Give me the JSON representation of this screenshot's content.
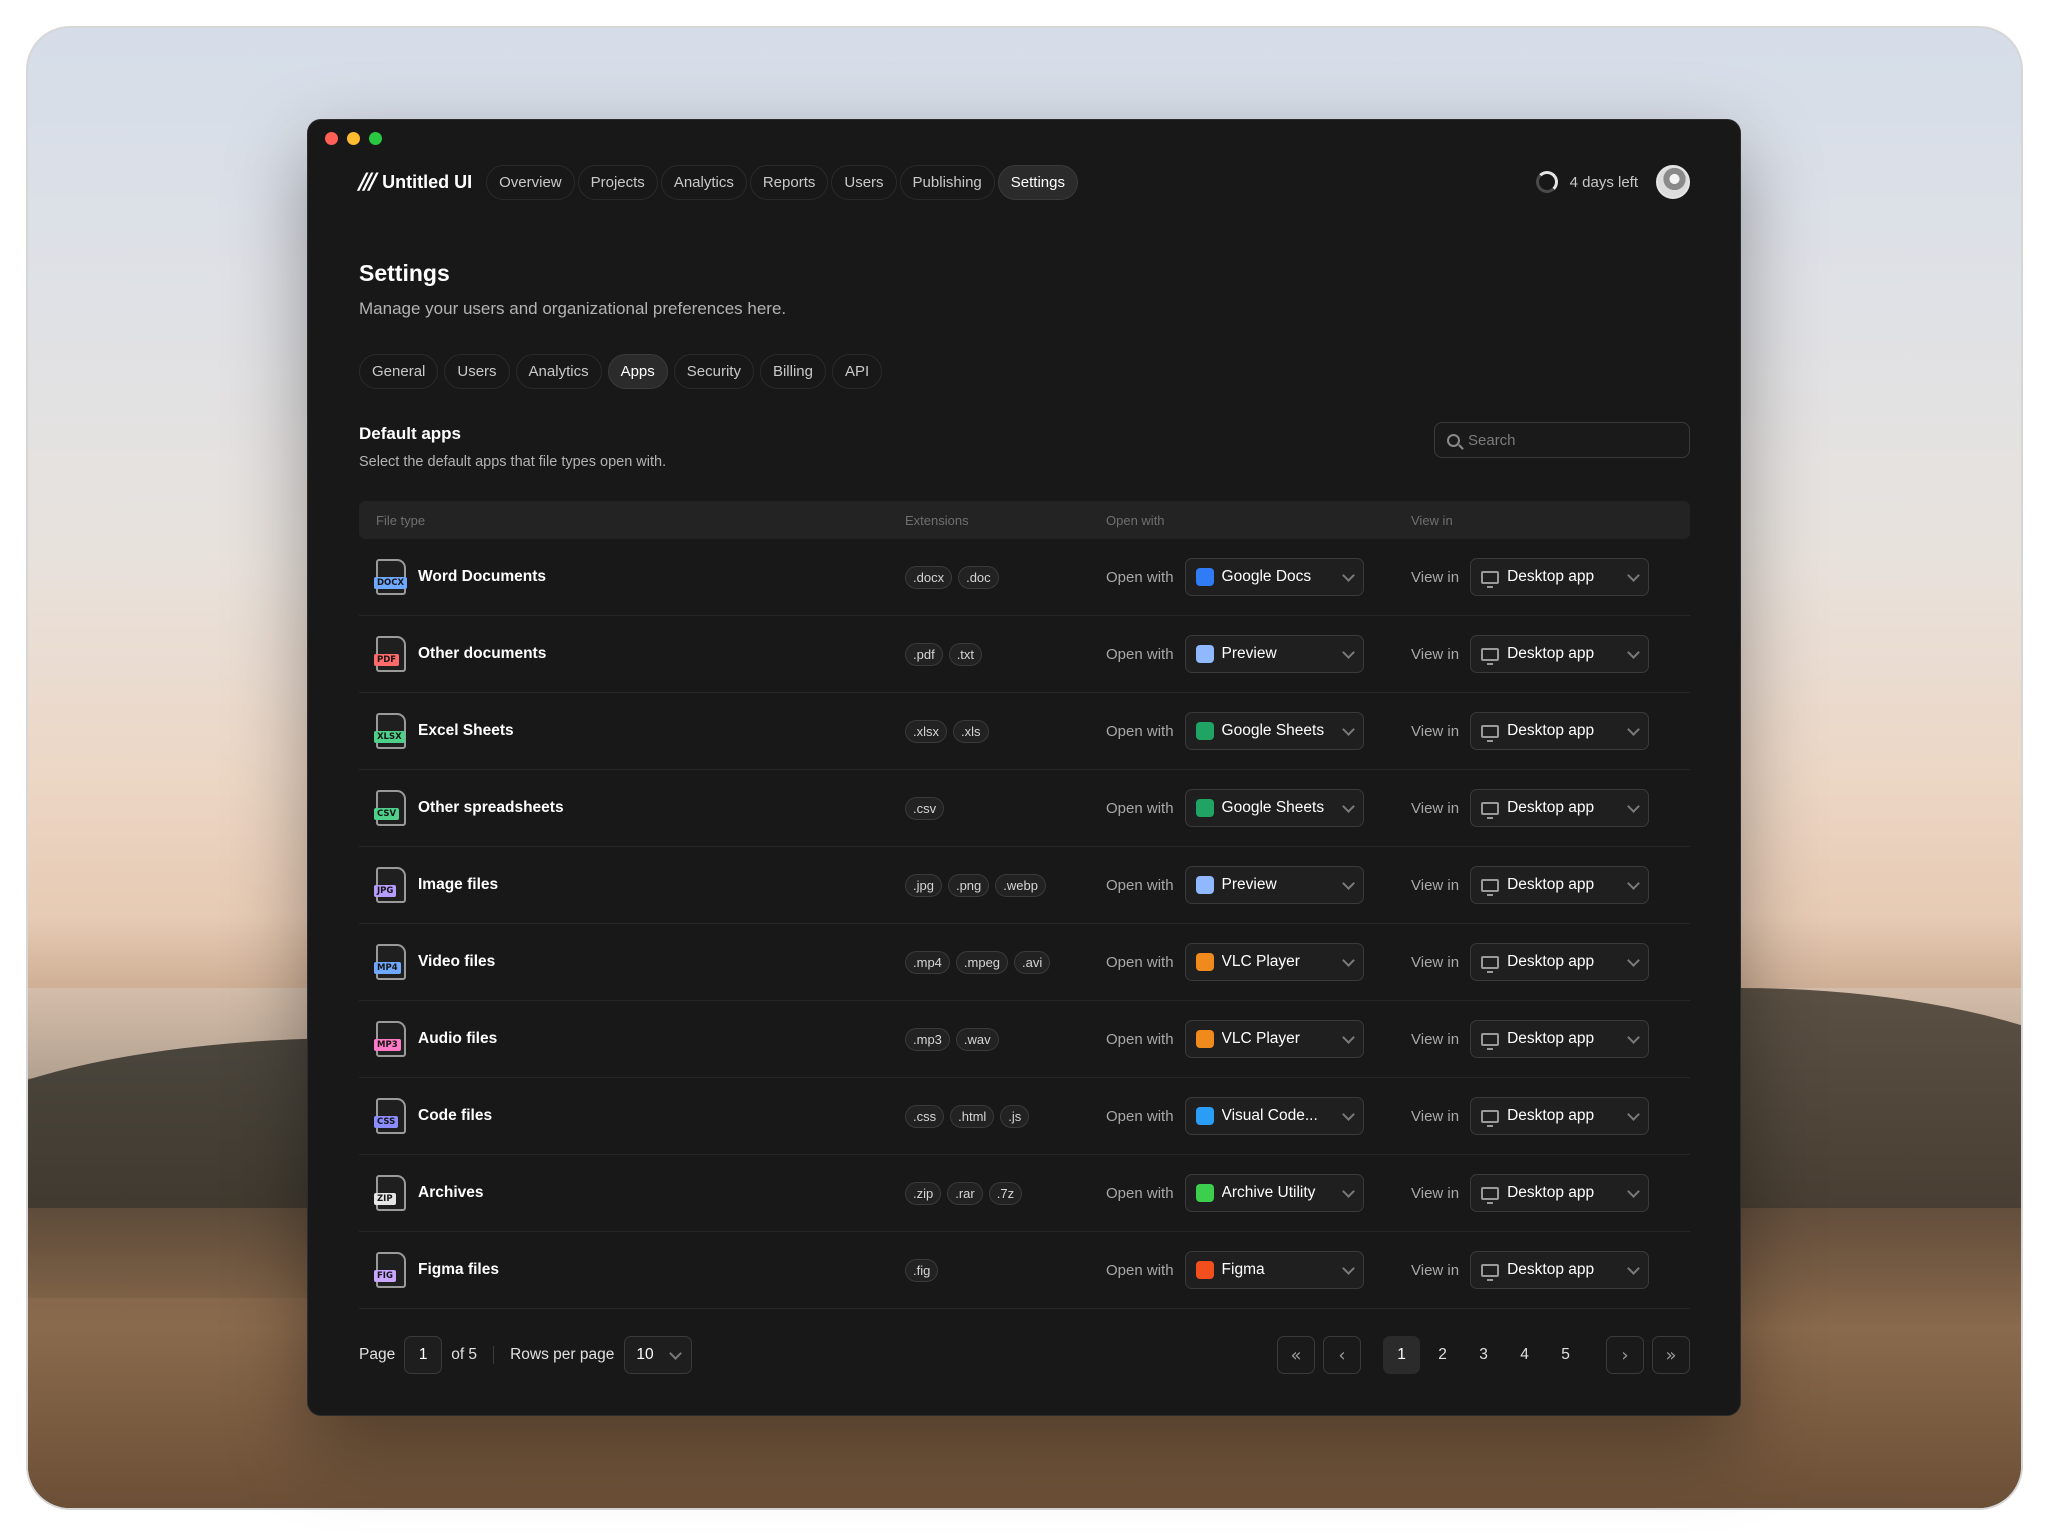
{
  "app": {
    "logo_mark": "///",
    "name": "Untitled UI"
  },
  "nav": {
    "items": [
      {
        "label": "Overview"
      },
      {
        "label": "Projects"
      },
      {
        "label": "Analytics"
      },
      {
        "label": "Reports"
      },
      {
        "label": "Users"
      },
      {
        "label": "Publishing"
      },
      {
        "label": "Settings",
        "active": true
      }
    ]
  },
  "trial": {
    "text": "4 days left"
  },
  "header": {
    "title": "Settings",
    "subtitle": "Manage your users and organizational preferences here."
  },
  "tabs": [
    {
      "label": "General"
    },
    {
      "label": "Users"
    },
    {
      "label": "Analytics"
    },
    {
      "label": "Apps",
      "active": true
    },
    {
      "label": "Security"
    },
    {
      "label": "Billing"
    },
    {
      "label": "API"
    }
  ],
  "section": {
    "title": "Default apps",
    "subtitle": "Select the default apps that file types open with."
  },
  "search": {
    "placeholder": "Search",
    "value": ""
  },
  "table": {
    "columns": [
      "File type",
      "Extensions",
      "Open with",
      "View in"
    ],
    "open_label": "Open with",
    "view_label": "View in",
    "rows": [
      {
        "name": "Word Documents",
        "badge": "DOCX",
        "badge_color": "#6fa8ff",
        "extensions": [
          ".docx",
          ".doc"
        ],
        "app": "Google Docs",
        "app_icon": "google-docs-icon",
        "app_color": "#2f7cf6",
        "view": "Desktop app"
      },
      {
        "name": "Other documents",
        "badge": "PDF",
        "badge_color": "#ff6b6b",
        "extensions": [
          ".pdf",
          ".txt"
        ],
        "app": "Preview",
        "app_icon": "preview-icon",
        "app_color": "#8fb8ff",
        "view": "Desktop app"
      },
      {
        "name": "Excel Sheets",
        "badge": "XLSX",
        "badge_color": "#4fd08a",
        "extensions": [
          ".xlsx",
          ".xls"
        ],
        "app": "Google Sheets",
        "app_icon": "google-sheets-icon",
        "app_color": "#1fa463",
        "view": "Desktop app"
      },
      {
        "name": "Other spreadsheets",
        "badge": "CSV",
        "badge_color": "#4fd08a",
        "extensions": [
          ".csv"
        ],
        "app": "Google Sheets",
        "app_icon": "google-sheets-icon",
        "app_color": "#1fa463",
        "view": "Desktop app"
      },
      {
        "name": "Image files",
        "badge": "JPG",
        "badge_color": "#b79cff",
        "extensions": [
          ".jpg",
          ".png",
          ".webp"
        ],
        "app": "Preview",
        "app_icon": "preview-icon",
        "app_color": "#8fb8ff",
        "view": "Desktop app"
      },
      {
        "name": "Video files",
        "badge": "MP4",
        "badge_color": "#6fa8ff",
        "extensions": [
          ".mp4",
          ".mpeg",
          ".avi"
        ],
        "app": "VLC Player",
        "app_icon": "vlc-icon",
        "app_color": "#f08a1c",
        "view": "Desktop app"
      },
      {
        "name": "Audio files",
        "badge": "MP3",
        "badge_color": "#ff7ac6",
        "extensions": [
          ".mp3",
          ".wav"
        ],
        "app": "VLC Player",
        "app_icon": "vlc-icon",
        "app_color": "#f08a1c",
        "view": "Desktop app"
      },
      {
        "name": "Code files",
        "badge": "CSS",
        "badge_color": "#8b8cff",
        "extensions": [
          ".css",
          ".html",
          ".js"
        ],
        "app": "Visual Code...",
        "app_icon": "vscode-icon",
        "app_color": "#2a9df4",
        "view": "Desktop app"
      },
      {
        "name": "Archives",
        "badge": "ZIP",
        "badge_color": "#e6e6e6",
        "extensions": [
          ".zip",
          ".rar",
          ".7z"
        ],
        "app": "Archive Utility",
        "app_icon": "archive-utility-icon",
        "app_color": "#3ccf4e",
        "view": "Desktop app"
      },
      {
        "name": "Figma files",
        "badge": "FIG",
        "badge_color": "#c9a6ff",
        "extensions": [
          ".fig"
        ],
        "app": "Figma",
        "app_icon": "figma-icon",
        "app_color": "#f24e1e",
        "view": "Desktop app"
      }
    ]
  },
  "pagination": {
    "page_label": "Page",
    "current_page": "1",
    "of_label": "of 5",
    "rows_label": "Rows per page",
    "rows_value": "10",
    "pages": [
      "1",
      "2",
      "3",
      "4",
      "5"
    ],
    "first": "«",
    "prev": "‹",
    "next": "›",
    "last": "»"
  }
}
